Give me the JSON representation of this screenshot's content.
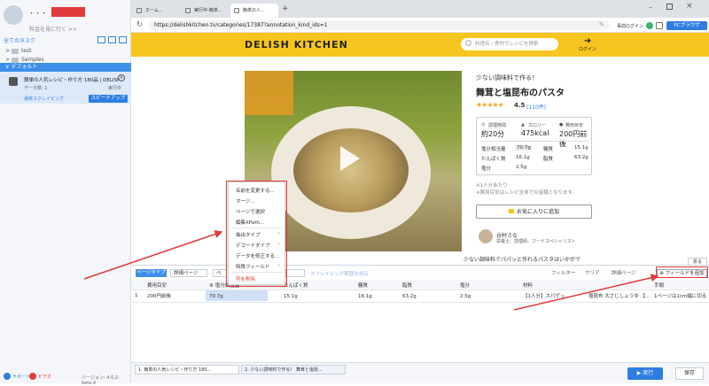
{
  "sidebar": {
    "user_name": "・・・",
    "upgrade_link": "料金を見に行く >>",
    "all_tasks": "全てのタスク",
    "folders": [
      {
        "label": "test"
      },
      {
        "label": "Samples"
      }
    ],
    "default_group": "デフォルト",
    "task": {
      "title": "簡単の人気レシピ・作り方 180品 | DELISH...",
      "data_count": "データ数: 1",
      "status": "実行中",
      "mode": "通常スクレイピング",
      "speed_button": "スピードアップ"
    },
    "footer": {
      "support": "サポート",
      "video": "ビデオ",
      "version": "バージョン: 4.0.2-beta.4"
    }
  },
  "browser": {
    "tabs": [
      {
        "label": "ホーム..."
      },
      {
        "label": "実行中-簡単..."
      },
      {
        "label": "簡単の人..."
      }
    ],
    "new_tab": "+",
    "url": "https://delishkitchen.tv/categories/17387?annotation_kind_ids=1",
    "pre_login": "事前ログイン",
    "pc_browser": "PCブラウザ"
  },
  "site": {
    "logo": "DELISH KITCHEN",
    "search_placeholder": "料理名・食材でレシピを検索",
    "login": "ログイン"
  },
  "recipe": {
    "subtitle": "少ない調味料で作る！",
    "title": "舞茸と塩昆布のパスタ",
    "stars": "★★★★★",
    "rating": 4.5,
    "rating_text": "4.5",
    "reviews": "(110件)",
    "time_label": "調理時間",
    "time_value": "約20分",
    "calorie_label": "カロリー",
    "calorie_value": "475kcal",
    "cost_label": "費用目安",
    "cost_value": "200円前後",
    "nutrition": [
      {
        "label": "塩分相当量",
        "value": "70.7g"
      },
      {
        "label": "糖質",
        "value": "15.1g"
      },
      {
        "label": "たんぱく質",
        "value": "16.1g"
      },
      {
        "label": "脂質",
        "value": "63.2g"
      },
      {
        "label": "塩分",
        "value": "2.5g"
      }
    ],
    "serving": "※1人分あたり",
    "serving_note": "※費用目安はレシピ全体での金額となります。",
    "favorite_button": "お気に入りに追加",
    "author_name": "谷村さな",
    "author_role": "栄養士、調理師、フードスペシャリスト",
    "description": "少ない調味料でパパッと作れるパスタはいかがで"
  },
  "context_menu": {
    "items": [
      {
        "label": "名前を変更する..."
      },
      {
        "label": "マージ..."
      },
      {
        "label": "ページで選択"
      },
      {
        "label": "編集XPath..."
      },
      {
        "label": "抽出タイプ"
      },
      {
        "label": "デコードタイプ"
      },
      {
        "label": "データを修正する..."
      },
      {
        "label": "特殊フィールド"
      },
      {
        "label": "列を削除"
      }
    ]
  },
  "bottom": {
    "page_type": "ページタイプ",
    "page_select": "詳細ページ",
    "select2": "ペ",
    "scroll_link": "スクレイピング範囲を設定",
    "filter": "フィルター",
    "clear": "クリア",
    "detail": "詳細ページ",
    "add_field": "フィールドを追加",
    "fold": "折る",
    "columns": [
      "費用目安",
      "塩分相当量",
      "たんぱく質",
      "糖質",
      "脂質",
      "塩分",
      "材料",
      "",
      "手順"
    ],
    "row": {
      "num": "1",
      "cells": [
        "200円前後",
        "70.7g",
        "15.1g",
        "16.1g",
        "63.2g",
        "2.5g",
        "【1人分】スパゲッ...",
        "塩昆布 大さじしょうゆ 【...",
        "1ページは1cm幅に切る..."
      ]
    }
  },
  "tasktabs": {
    "tab1": "1. 簡単の人気レシピ・作り方 180...",
    "tab2": "2. 少ない調味料で作る！ 舞茸と塩昆...",
    "run": "▶ 実行",
    "save": "保存"
  },
  "colors": {
    "accent": "#2f7de1",
    "highlight": "#e23b3b",
    "header_yellow": "#f7c51f"
  }
}
